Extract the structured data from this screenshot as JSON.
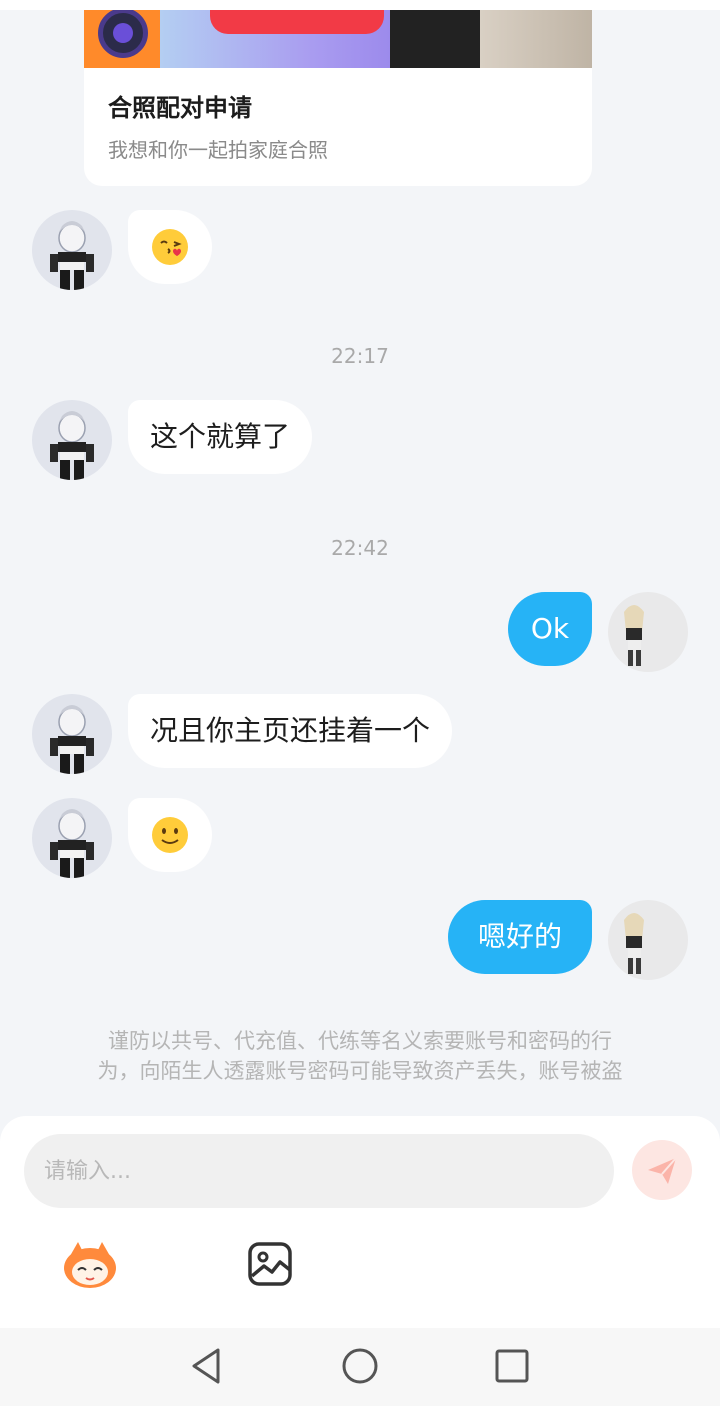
{
  "card": {
    "title": "合照配对申请",
    "subtitle": "我想和你一起拍家庭合照"
  },
  "messages": {
    "m1_emoji": "face-blowing-kiss",
    "time1": "22:17",
    "m2": "这个就算了",
    "time2": "22:42",
    "m3": "Ok",
    "m4": "况且你主页还挂着一个",
    "m5_emoji": "slightly-smiling-face",
    "m6": "嗯好的"
  },
  "notice": {
    "line1": "谨防以共号、代充值、代练等名义索要账号和密码的行",
    "line2": "为，向陌生人透露账号密码可能导致资产丢失，账号被盗"
  },
  "input": {
    "placeholder": "请输入..."
  },
  "icons": {
    "send": "send-icon",
    "sticker": "sticker-mascot-icon",
    "image": "image-icon",
    "nav_back": "back-triangle-icon",
    "nav_home": "home-circle-icon",
    "nav_recent": "recent-square-icon"
  },
  "colors": {
    "accent": "#26b3f6",
    "background": "#f3f5f8",
    "bubble_in": "#ffffff"
  }
}
